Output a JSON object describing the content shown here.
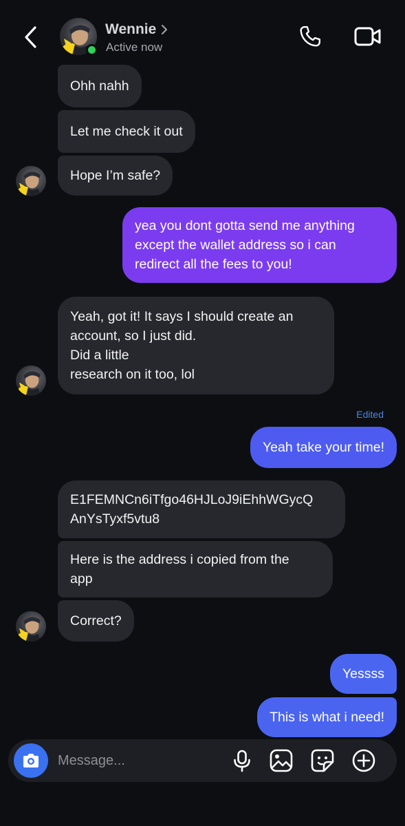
{
  "header": {
    "contact_name": "Wennie",
    "status": "Active now"
  },
  "messages": [
    {
      "side": "in",
      "text": "Ohh nahh"
    },
    {
      "side": "in",
      "text": "Let me check it out"
    },
    {
      "side": "in",
      "text": "Hope I’m safe?"
    },
    {
      "side": "out",
      "text": "yea you dont gotta send me anything\nexcept the wallet address so i can\nredirect all the fees to you!"
    },
    {
      "side": "in",
      "text": "Yeah, got it! It says I should create an\naccount, so I just did.\nDid a little\nresearch on it too, lol"
    },
    {
      "side": "out",
      "text": "Yeah take your time!",
      "meta": "Edited"
    },
    {
      "side": "in",
      "text": "E1FEMNCn6iTfgo46HJLoJ9iEhhWGycQ\nAnYsTyxf5vtu8"
    },
    {
      "side": "in",
      "text": "Here is the address i copied from the\napp"
    },
    {
      "side": "in",
      "text": "Correct?"
    },
    {
      "side": "out",
      "text": "Yessss"
    },
    {
      "side": "out",
      "text": "This is what i need!"
    }
  ],
  "composer": {
    "placeholder": "Message..."
  },
  "colors": {
    "background": "#0c0e12",
    "incoming_bubble": "#26282d",
    "outgoing_purple": "#7b3cf0",
    "outgoing_blue": "#4a64f0",
    "accent": "#3a71f0",
    "online": "#2fd157"
  },
  "icons": [
    "back-chevron-icon",
    "chevron-right-icon",
    "phone-icon",
    "video-camera-icon",
    "camera-icon",
    "microphone-icon",
    "image-icon",
    "sticker-icon",
    "plus-icon"
  ]
}
